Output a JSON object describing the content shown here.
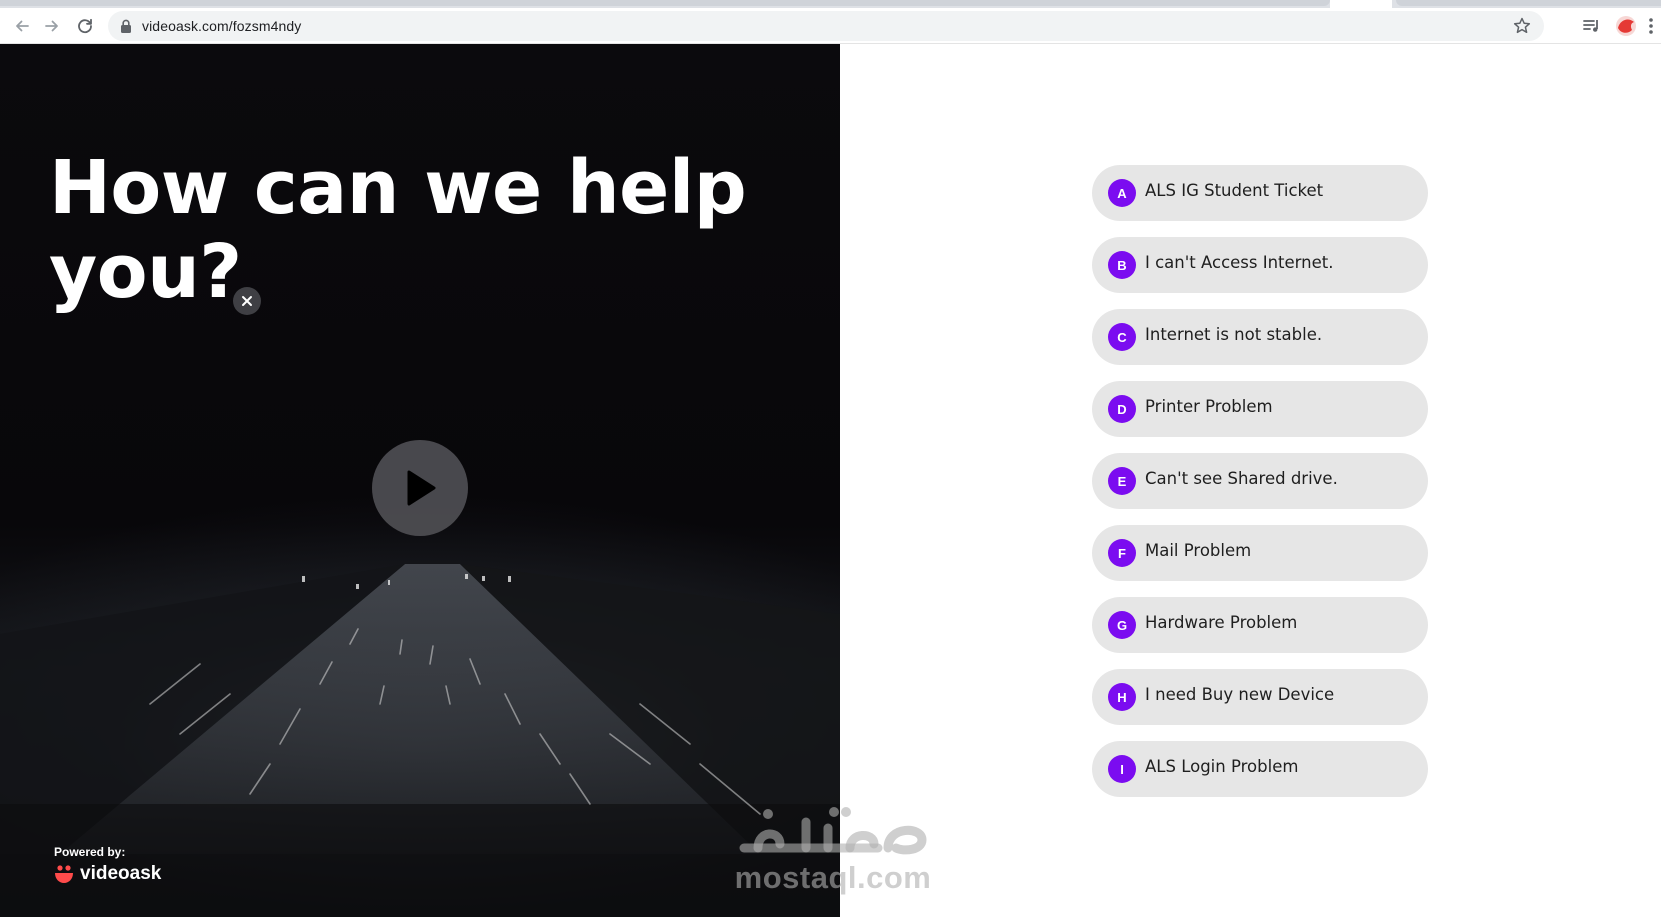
{
  "browser": {
    "url": "videoask.com/fozsm4ndy",
    "icons": {
      "back": "arrow-left-icon",
      "forward": "arrow-right-icon",
      "reload": "reload-icon",
      "lock": "lock-icon",
      "bookmark": "star-icon",
      "media": "media-queue-icon",
      "profile": "profile-avatar-icon",
      "menu": "kebab-menu-icon"
    }
  },
  "video": {
    "headline": "How can we help you?",
    "close_icon": "close-icon",
    "play_icon": "play-icon",
    "powered_by": "Powered by:",
    "brand": "videoask"
  },
  "options": [
    {
      "letter": "A",
      "label": "ALS IG Student Ticket"
    },
    {
      "letter": "B",
      "label": "I can't Access Internet."
    },
    {
      "letter": "C",
      "label": "Internet is not stable."
    },
    {
      "letter": "D",
      "label": "Printer Problem"
    },
    {
      "letter": "E",
      "label": "Can't see Shared drive."
    },
    {
      "letter": "F",
      "label": "Mail Problem"
    },
    {
      "letter": "G",
      "label": "Hardware Problem"
    },
    {
      "letter": "H",
      "label": "I need Buy new Device"
    },
    {
      "letter": "I",
      "label": "ALS Login Problem"
    }
  ],
  "watermark": {
    "logo_text": "مستقل",
    "text": "mostaql.com"
  },
  "colors": {
    "accent": "#7b0cf0",
    "option_bg": "#e6e6e6",
    "video_bg": "#0b0a0d",
    "brand_red": "#ff4b4b"
  }
}
